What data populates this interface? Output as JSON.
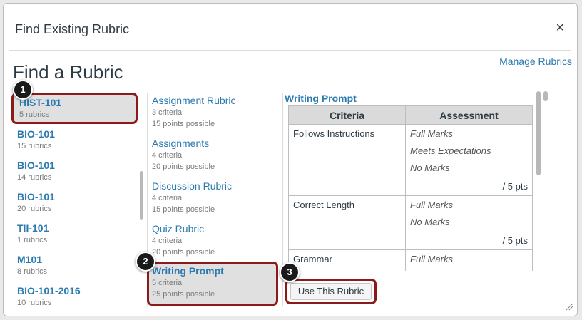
{
  "dialog": {
    "title": "Find Existing Rubric",
    "close_icon": "×",
    "manage_link": "Manage Rubrics",
    "heading": "Find a Rubric"
  },
  "courses": [
    {
      "name": "HIST-101",
      "count": "5 rubrics",
      "selected": true
    },
    {
      "name": "BIO-101",
      "count": "15 rubrics"
    },
    {
      "name": "BIO-101",
      "count": "14 rubrics"
    },
    {
      "name": "BIO-101",
      "count": "20 rubrics"
    },
    {
      "name": "TII-101",
      "count": "1 rubrics"
    },
    {
      "name": "M101",
      "count": "8 rubrics"
    },
    {
      "name": "BIO-101-2016",
      "count": "10 rubrics"
    }
  ],
  "rubrics": [
    {
      "name": "Assignment Rubric",
      "criteria": "3 criteria",
      "points": "15 points possible"
    },
    {
      "name": "Assignments",
      "criteria": "4 criteria",
      "points": "20 points possible"
    },
    {
      "name": "Discussion Rubric",
      "criteria": "4 criteria",
      "points": "15 points possible"
    },
    {
      "name": "Quiz Rubric",
      "criteria": "4 criteria",
      "points": "20 points possible"
    },
    {
      "name": "Writing Prompt",
      "criteria": "5 criteria",
      "points": "25 points possible",
      "selected": true
    }
  ],
  "preview": {
    "title": "Writing Prompt",
    "headers": {
      "criteria": "Criteria",
      "assessment": "Assessment"
    },
    "rows": [
      {
        "criterion": "Follows Instructions",
        "ratings": [
          "Full Marks",
          "Meets Expectations",
          "No Marks"
        ],
        "points": "/ 5 pts"
      },
      {
        "criterion": "Correct Length",
        "ratings": [
          "Full Marks",
          "No Marks"
        ],
        "points": "/ 5 pts"
      },
      {
        "criterion": "Grammar",
        "ratings": [
          "Full Marks"
        ],
        "points": ""
      }
    ]
  },
  "use_button": "Use This Rubric",
  "badges": [
    "1",
    "2",
    "3"
  ],
  "colors": {
    "link": "#2a7ab0",
    "highlight_border": "#8b1a1a",
    "selected_bg": "#e0e0e0"
  }
}
